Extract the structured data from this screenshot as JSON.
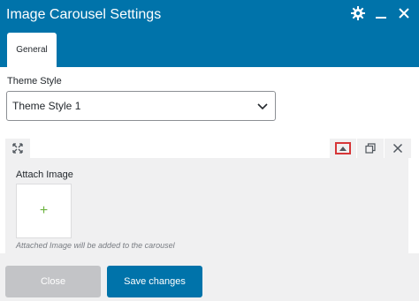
{
  "header": {
    "title": "Image Carousel Settings",
    "icons": [
      "gear-icon",
      "minimize-icon",
      "close-icon"
    ]
  },
  "tabs": [
    {
      "label": "General",
      "active": true
    }
  ],
  "theme_style": {
    "label": "Theme Style",
    "value": "Theme Style 1"
  },
  "repeater": {
    "attach_label": "Attach Image",
    "helper_text": "Attached Image will be added to the carousel",
    "add_symbol": "+",
    "controls": [
      "expand-icon",
      "collapse-icon",
      "clone-icon",
      "remove-icon"
    ]
  },
  "footer": {
    "close_label": "Close",
    "save_label": "Save changes"
  },
  "colors": {
    "primary": "#0073aa",
    "panel": "#f0f0f1",
    "disabled_button": "#c3c4c7",
    "highlight": "#d63638",
    "add_icon": "#6cb33f"
  }
}
